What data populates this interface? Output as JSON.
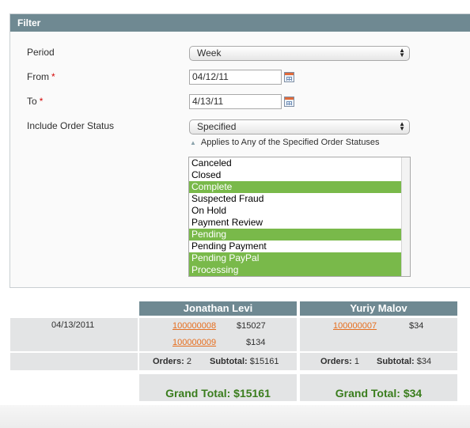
{
  "filter": {
    "title": "Filter",
    "period_label": "Period",
    "period_value": "Week",
    "from_label": "From",
    "from_value": "04/12/11",
    "to_label": "To",
    "to_value": "4/13/11",
    "required_mark": "*",
    "status_label": "Include Order Status",
    "status_value": "Specified",
    "hint": "Applies to Any of the Specified Order Statuses",
    "statuses": [
      {
        "label": "Canceled",
        "selected": false
      },
      {
        "label": "Closed",
        "selected": false
      },
      {
        "label": "Complete",
        "selected": true
      },
      {
        "label": "Suspected Fraud",
        "selected": false
      },
      {
        "label": "On Hold",
        "selected": false
      },
      {
        "label": "Payment Review",
        "selected": false
      },
      {
        "label": "Pending",
        "selected": true
      },
      {
        "label": "Pending Payment",
        "selected": false
      },
      {
        "label": "Pending PayPal",
        "selected": true
      },
      {
        "label": "Processing",
        "selected": true
      }
    ],
    "selected_color": "#79b94a"
  },
  "report": {
    "date": "04/13/2011",
    "columns": [
      {
        "name": "Jonathan Levi",
        "orders": [
          {
            "id": "100000008",
            "amount": "$15027"
          },
          {
            "id": "100000009",
            "amount": "$134"
          }
        ],
        "orders_label": "Orders:",
        "orders_count": "2",
        "subtotal_label": "Subtotal:",
        "subtotal": "$15161",
        "grand_total": "Grand Total: $15161"
      },
      {
        "name": "Yuriy Malov",
        "orders": [
          {
            "id": "100000007",
            "amount": "$34"
          }
        ],
        "orders_label": "Orders:",
        "orders_count": "1",
        "subtotal_label": "Subtotal:",
        "subtotal": "$34",
        "grand_total": "Grand Total: $34"
      }
    ],
    "header_color": "#6f8992",
    "link_color": "#e66e1e",
    "grand_total_color": "#3a7d1d"
  }
}
